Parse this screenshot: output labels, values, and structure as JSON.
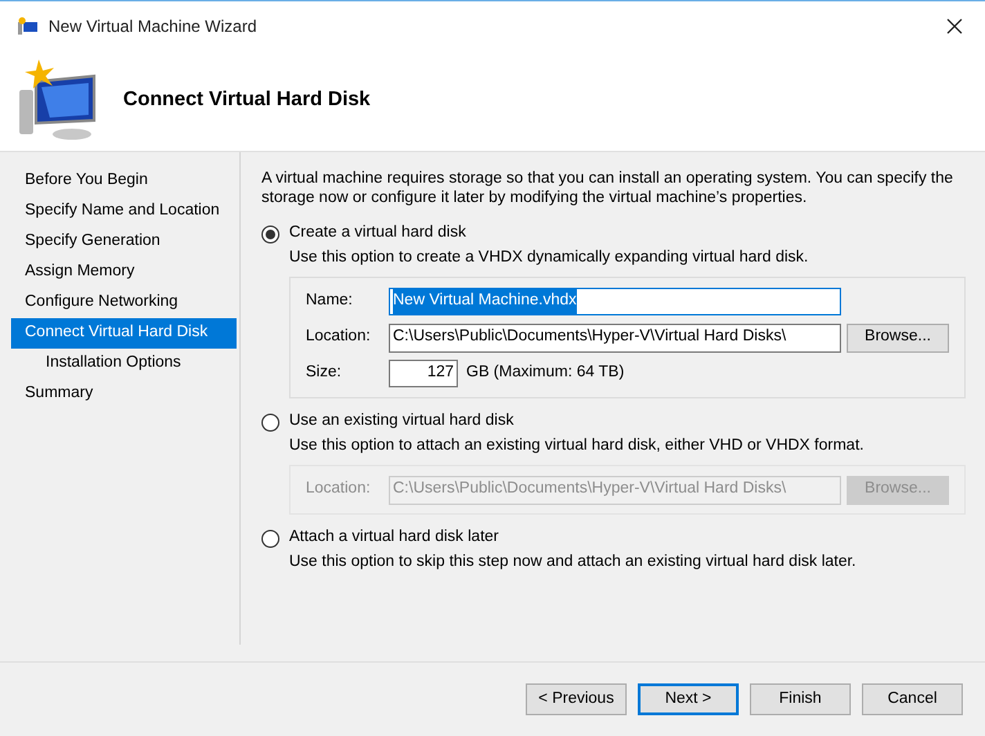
{
  "window": {
    "title": "New Virtual Machine Wizard"
  },
  "header": {
    "title": "Connect Virtual Hard Disk"
  },
  "sidebar": {
    "items": [
      {
        "label": "Before You Begin",
        "selected": false
      },
      {
        "label": "Specify Name and Location",
        "selected": false
      },
      {
        "label": "Specify Generation",
        "selected": false
      },
      {
        "label": "Assign Memory",
        "selected": false
      },
      {
        "label": "Configure Networking",
        "selected": false
      },
      {
        "label": "Connect Virtual Hard Disk",
        "selected": true,
        "children": [
          {
            "label": "Installation Options",
            "selected": false
          }
        ]
      },
      {
        "label": "Summary",
        "selected": false
      }
    ]
  },
  "intro": "A virtual machine requires storage so that you can install an operating system. You can specify the storage now or configure it later by modifying the virtual machine’s properties.",
  "options": [
    {
      "label": "Create a virtual hard disk",
      "selected": true,
      "description": "Use this option to create a VHDX dynamically expanding virtual hard disk.",
      "rows": [
        {
          "kind": "text",
          "label": "Name:",
          "value": "New Virtual Machine.vhdx",
          "highlighted": true
        },
        {
          "kind": "path",
          "label": "Location:",
          "value": "C:\\Users\\Public\\Documents\\Hyper-V\\Virtual Hard Disks\\",
          "button": "Browse..."
        },
        {
          "kind": "size",
          "label": "Size:",
          "value": "127",
          "suffix": "GB (Maximum: 64 TB)"
        }
      ]
    },
    {
      "label": "Use an existing virtual hard disk",
      "selected": false,
      "description": "Use this option to attach an existing virtual hard disk, either VHD or VHDX format.",
      "disabled": true,
      "rows": [
        {
          "kind": "path",
          "label": "Location:",
          "value": "C:\\Users\\Public\\Documents\\Hyper-V\\Virtual Hard Disks\\",
          "button": "Browse..."
        }
      ]
    },
    {
      "label": "Attach a virtual hard disk later",
      "selected": false,
      "description": "Use this option to skip this step now and attach an existing virtual hard disk later."
    }
  ],
  "buttons": [
    {
      "label": "< Previous",
      "focused": false
    },
    {
      "label": "Next >",
      "focused": true
    },
    {
      "label": "Finish",
      "focused": false
    },
    {
      "label": "Cancel",
      "focused": false
    }
  ]
}
